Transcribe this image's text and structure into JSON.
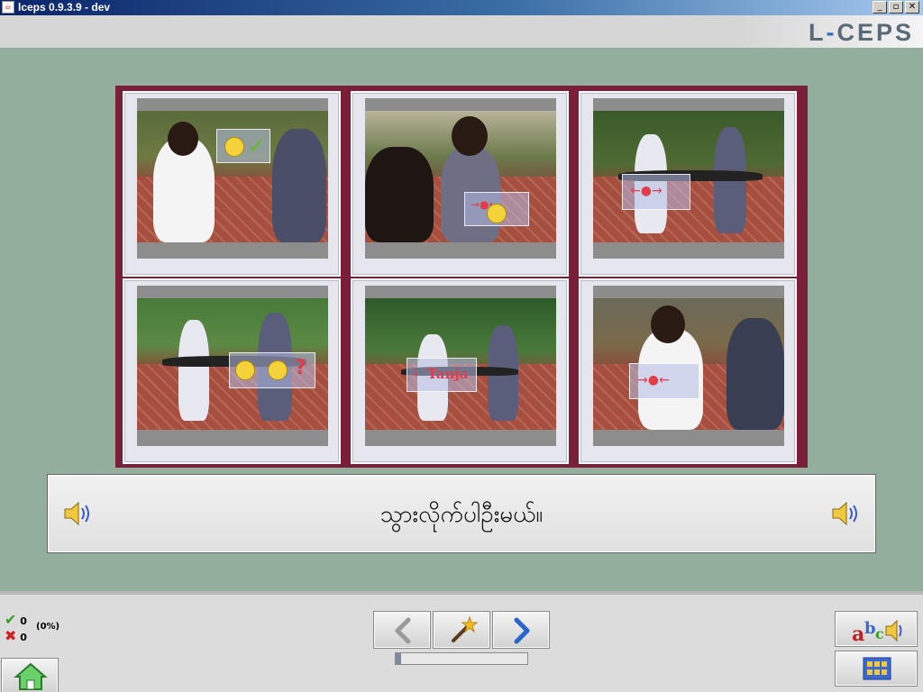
{
  "window": {
    "title": "lceps 0.9.3.9 - dev",
    "controls": [
      "minimize",
      "maximize",
      "close"
    ]
  },
  "header": {
    "logo_left": "L",
    "logo_dash": "-",
    "logo_right": "CEPS"
  },
  "grid": {
    "cells": [
      {
        "overlay": "smiley-check"
      },
      {
        "overlay": "smiley-arrows-in"
      },
      {
        "overlay": "arrows-out"
      },
      {
        "overlay": "smiley-confused-question"
      },
      {
        "overlay": "name-tag",
        "label": "Tanja"
      },
      {
        "overlay": "arrows-in"
      }
    ]
  },
  "sentence": {
    "text": "သွားလိုက်ပါဦးမယ်။",
    "left_icon": "speaker-icon",
    "right_icon": "speaker-icon"
  },
  "score": {
    "correct": "0",
    "wrong": "0",
    "percent": "(0%)"
  },
  "nav": {
    "back_icon": "arrow-left-icon",
    "hint_icon": "magic-wand-icon",
    "next_icon": "arrow-right-icon"
  },
  "progress": {
    "fraction": 0.04
  },
  "side": {
    "top_icon": "abc-speaker-icon",
    "bottom_icon": "grid-icon",
    "home_icon": "home-icon"
  },
  "colors": {
    "background": "#94ae9e",
    "grid_frame": "#7a1f3a",
    "accent": "#2e6fc2"
  }
}
